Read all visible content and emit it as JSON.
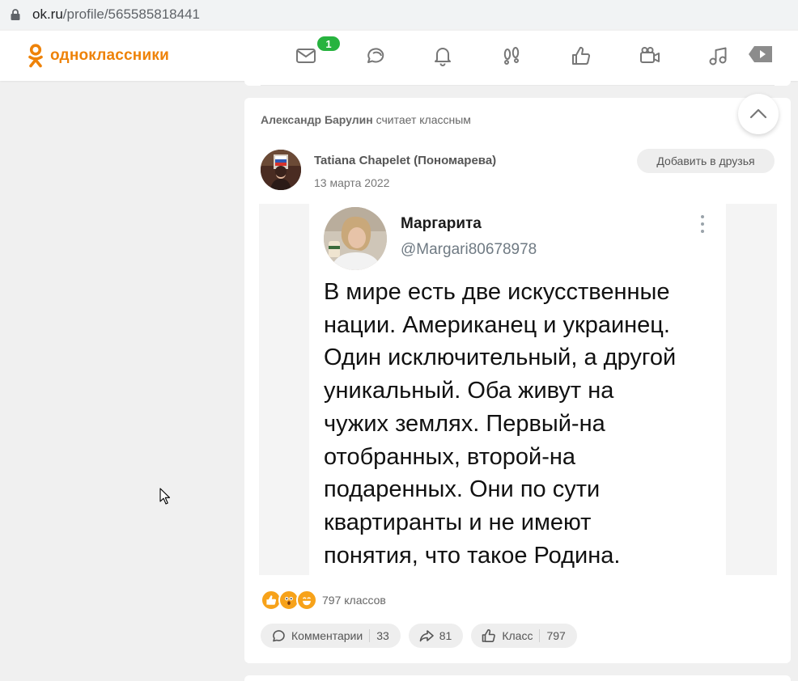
{
  "browser": {
    "url_host": "ok.ru",
    "url_path": "/profile/565585818441"
  },
  "header": {
    "logo_text": "одноклассники",
    "brand_color": "#ee8208",
    "messages_badge": "1",
    "nav_icons": [
      "mail-icon",
      "discussions-icon",
      "bell-icon",
      "guests-icon",
      "likes-icon",
      "video-camera-icon",
      "music-icon",
      "video-play-icon"
    ]
  },
  "feed_item": {
    "actor": "Александр Барулин",
    "action_text": "считает классным",
    "author": "Tatiana Chapelet (Пономарева)",
    "date": "13 марта 2022",
    "add_friend_label": "Добавить в друзья",
    "image": {
      "tweet_name": "Маргарита",
      "tweet_handle": "@Margari80678978",
      "tweet_text_lines": [
        "В мире есть две искусственные",
        "нации. Американец и украинец.",
        "Один исключительный, а другой",
        "уникальный. Оба живут на",
        "чужих землях. Первый-на",
        "отобранных, второй-на",
        "подаренных. Они по сути",
        "квартиранты и не имеют",
        "понятия, что такое Родина."
      ]
    },
    "reactions_count_label": "797 классов",
    "reaction_icons": [
      "thumbs-up-icon",
      "wow-icon",
      "laugh-icon"
    ],
    "actions": {
      "comments_label": "Комментарии",
      "comments_count": "33",
      "shares_count": "81",
      "class_label": "Класс",
      "class_count": "797"
    }
  }
}
